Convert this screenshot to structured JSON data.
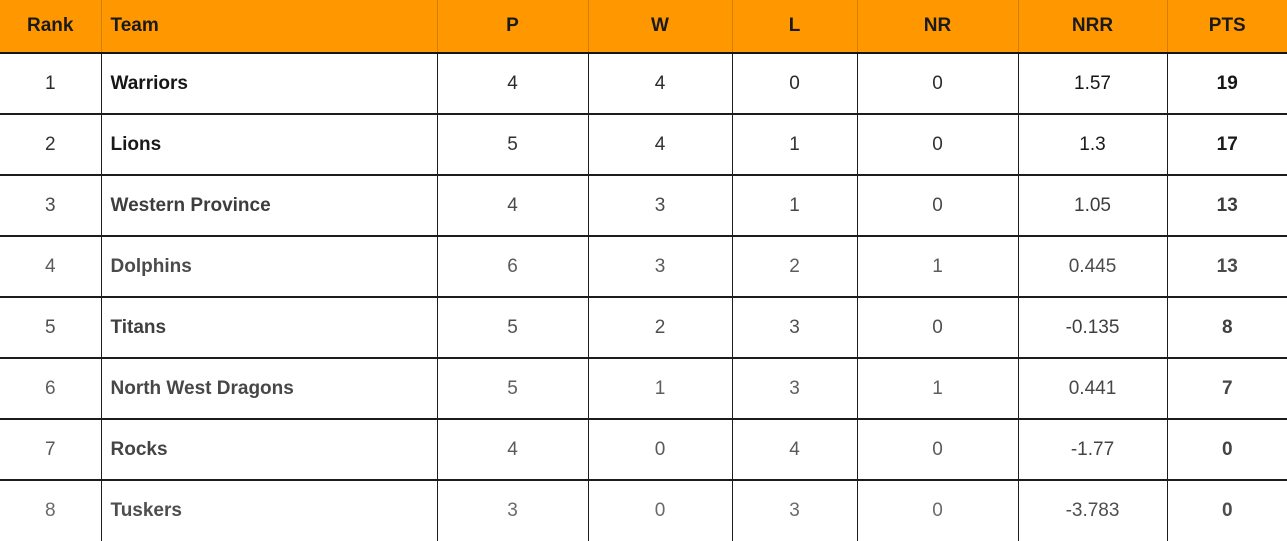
{
  "table": {
    "name": "points-table",
    "accent_color": "#ff9800",
    "header_text_color": "#1a1a1a",
    "columns": [
      {
        "key": "rank",
        "label": "Rank"
      },
      {
        "key": "team",
        "label": "Team"
      },
      {
        "key": "p",
        "label": "P"
      },
      {
        "key": "w",
        "label": "W"
      },
      {
        "key": "l",
        "label": "L"
      },
      {
        "key": "nr",
        "label": "NR"
      },
      {
        "key": "nrr",
        "label": "NRR"
      },
      {
        "key": "pts",
        "label": "PTS"
      }
    ],
    "rows": [
      {
        "rank": "1",
        "team": "Warriors",
        "p": "4",
        "w": "4",
        "l": "0",
        "nr": "0",
        "nrr": "1.57",
        "pts": "19"
      },
      {
        "rank": "2",
        "team": "Lions",
        "p": "5",
        "w": "4",
        "l": "1",
        "nr": "0",
        "nrr": "1.3",
        "pts": "17"
      },
      {
        "rank": "3",
        "team": "Western Province",
        "p": "4",
        "w": "3",
        "l": "1",
        "nr": "0",
        "nrr": "1.05",
        "pts": "13"
      },
      {
        "rank": "4",
        "team": "Dolphins",
        "p": "6",
        "w": "3",
        "l": "2",
        "nr": "1",
        "nrr": "0.445",
        "pts": "13"
      },
      {
        "rank": "5",
        "team": "Titans",
        "p": "5",
        "w": "2",
        "l": "3",
        "nr": "0",
        "nrr": "-0.135",
        "pts": "8"
      },
      {
        "rank": "6",
        "team": "North West Dragons",
        "p": "5",
        "w": "1",
        "l": "3",
        "nr": "1",
        "nrr": "0.441",
        "pts": "7"
      },
      {
        "rank": "7",
        "team": "Rocks",
        "p": "4",
        "w": "0",
        "l": "4",
        "nr": "0",
        "nrr": "-1.77",
        "pts": "0"
      },
      {
        "rank": "8",
        "team": "Tuskers",
        "p": "3",
        "w": "0",
        "l": "3",
        "nr": "0",
        "nrr": "-3.783",
        "pts": "0"
      }
    ]
  }
}
